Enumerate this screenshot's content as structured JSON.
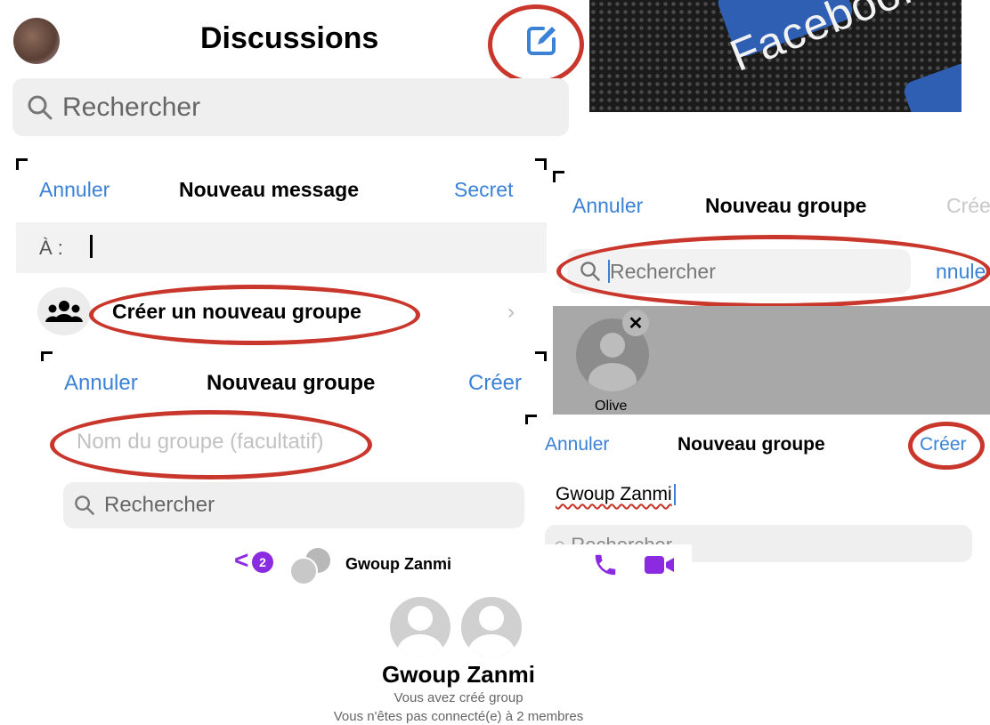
{
  "discussions": {
    "title": "Discussions",
    "search_placeholder": "Rechercher"
  },
  "facebook_banner": {
    "logo_text": "Facebook"
  },
  "new_message": {
    "cancel": "Annuler",
    "title": "Nouveau message",
    "secret": "Secret",
    "to_label": "À :",
    "create_group": "Créer un nouveau groupe"
  },
  "new_group_1": {
    "cancel": "Annuler",
    "title": "Nouveau groupe",
    "create": "Créer",
    "name_placeholder": "Nom du groupe (facultatif)",
    "search_placeholder": "Rechercher"
  },
  "new_group_2": {
    "cancel": "Annuler",
    "title": "Nouveau groupe",
    "create_partial": "Crée",
    "search_placeholder": "Rechercher",
    "cancel_partial": "nnule",
    "selected_contact": "Olive"
  },
  "new_group_3": {
    "cancel": "Annuler",
    "title": "Nouveau groupe",
    "create": "Créer",
    "group_name_value": "Gwoup Zanmi",
    "search_partial": "Rechercher"
  },
  "chat": {
    "back_badge": "2",
    "header_title": "Gwoup Zanmi",
    "group_name": "Gwoup Zanmi",
    "created_text": "Vous avez créé group",
    "not_connected_text": "Vous n'êtes pas connecté(e) à 2 membres"
  },
  "colors": {
    "accent_blue": "#3b82d6",
    "annotation_red": "#c9372c",
    "messenger_purple": "#8a2be2"
  }
}
